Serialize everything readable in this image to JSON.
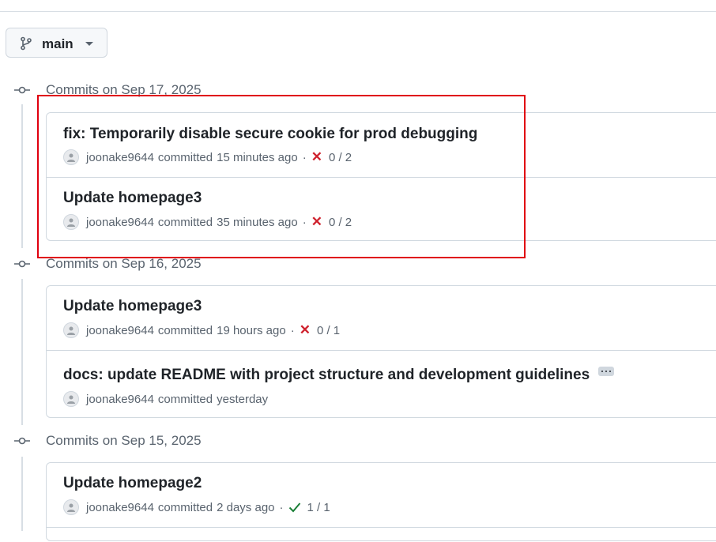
{
  "branch": {
    "name": "main",
    "icon": "git-branch-icon"
  },
  "groups": [
    {
      "header": "Commits on Sep 17, 2025",
      "commits": [
        {
          "title": "fix: Temporarily disable secure cookie for prod debugging",
          "author": "joonake9644",
          "committed": "committed",
          "time": "15 minutes ago",
          "sep": "·",
          "status": "failure",
          "checks": "0 / 2"
        },
        {
          "title": "Update homepage3",
          "author": "joonake9644",
          "committed": "committed",
          "time": "35 minutes ago",
          "sep": "·",
          "status": "failure",
          "checks": "0 / 2"
        }
      ]
    },
    {
      "header": "Commits on Sep 16, 2025",
      "commits": [
        {
          "title": "Update homepage3",
          "author": "joonake9644",
          "committed": "committed",
          "time": "19 hours ago",
          "sep": "·",
          "status": "failure",
          "checks": "0 / 1"
        },
        {
          "title": "docs: update README with project structure and development guidelines",
          "author": "joonake9644",
          "committed": "committed",
          "time": "yesterday"
        }
      ]
    },
    {
      "header": "Commits on Sep 15, 2025",
      "commits": [
        {
          "title": "Update homepage2",
          "author": "joonake9644",
          "committed": "committed",
          "time": "2 days ago",
          "sep": "·",
          "status": "success",
          "checks": "1 / 1"
        }
      ]
    }
  ],
  "status_symbols": {
    "failure": "✕"
  },
  "colors": {
    "failure": "#cf222e",
    "success": "#1a7f37",
    "highlight": "#e0000f"
  }
}
